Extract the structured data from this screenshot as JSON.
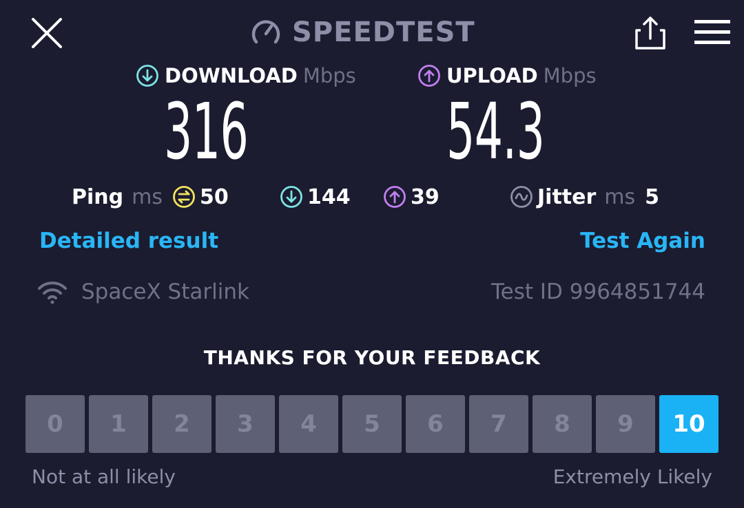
{
  "header": {
    "title": "SPEEDTEST",
    "close_icon": "close-icon",
    "brand_icon": "speedometer-icon",
    "share_icon": "share-icon",
    "menu_icon": "hamburger-menu-icon"
  },
  "download": {
    "label": "DOWNLOAD",
    "unit": "Mbps",
    "value": "316",
    "icon": "download-arrow-icon",
    "color": "#7de3e4"
  },
  "upload": {
    "label": "UPLOAD",
    "unit": "Mbps",
    "value": "54.3",
    "icon": "upload-arrow-icon",
    "color": "#c17ff0"
  },
  "stats": {
    "ping": {
      "label": "Ping",
      "unit": "ms",
      "value": "50",
      "icon": "ping-icon",
      "color": "#f2e35c"
    },
    "download_ping": {
      "value": "144",
      "icon": "download-arrow-icon"
    },
    "upload_ping": {
      "value": "39",
      "icon": "upload-arrow-icon"
    },
    "jitter": {
      "label": "Jitter",
      "unit": "ms",
      "value": "5",
      "icon": "jitter-icon"
    }
  },
  "links": {
    "detailed": "Detailed result",
    "again": "Test Again",
    "color": "#29b6f6"
  },
  "connection": {
    "provider": "SpaceX Starlink",
    "provider_icon": "wifi-icon",
    "test_id": "Test ID 9964851744"
  },
  "feedback": {
    "title": "THANKS FOR YOUR FEEDBACK",
    "options": [
      "0",
      "1",
      "2",
      "3",
      "4",
      "5",
      "6",
      "7",
      "8",
      "9",
      "10"
    ],
    "selected": "10",
    "low_label": "Not at all likely",
    "high_label": "Extremely Likely",
    "selected_color": "#1ab2f5"
  }
}
